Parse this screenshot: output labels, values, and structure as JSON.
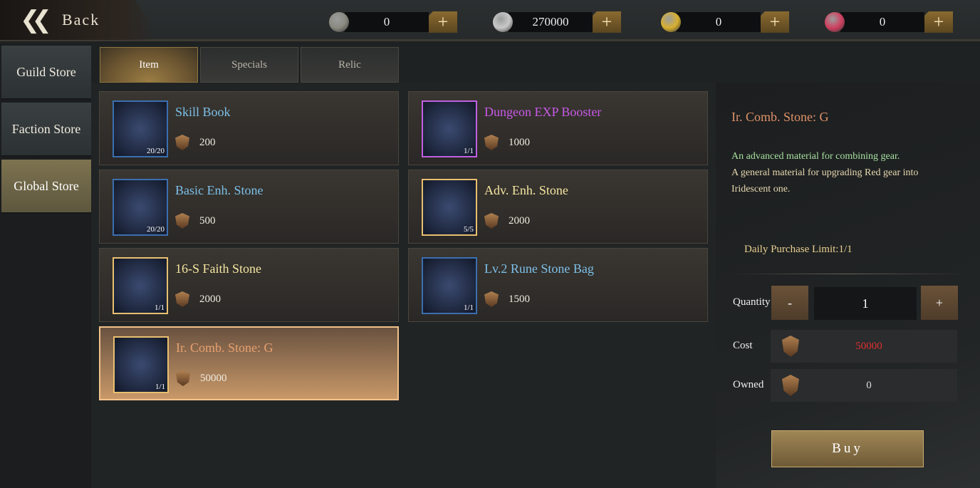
{
  "header": {
    "back_label": "Back",
    "currencies": [
      {
        "icon": "compass-coin-icon",
        "value": "0",
        "color": "#8a8a80"
      },
      {
        "icon": "silver-coin-icon",
        "value": "270000",
        "color": "#c8c8c8"
      },
      {
        "icon": "gold-coin-icon",
        "value": "0",
        "color": "#d8b030"
      },
      {
        "icon": "ruby-gem-icon",
        "value": "0",
        "color": "#d04060"
      }
    ]
  },
  "sidebar": {
    "items": [
      {
        "label": "Guild Store"
      },
      {
        "label": "Faction Store"
      },
      {
        "label": "Global Store",
        "active": true
      }
    ]
  },
  "tabs": [
    {
      "label": "Item",
      "active": true
    },
    {
      "label": "Specials"
    },
    {
      "label": "Relic"
    }
  ],
  "items": [
    {
      "name": "Skill Book",
      "price": "200",
      "count": "20/20",
      "color": "#7cc0e8"
    },
    {
      "name": "Dungeon EXP Booster",
      "price": "1000",
      "count": "1/1",
      "color": "#c85ae8"
    },
    {
      "name": "Basic Enh. Stone",
      "price": "500",
      "count": "20/20",
      "color": "#7cc0e8"
    },
    {
      "name": "Adv. Enh. Stone",
      "price": "2000",
      "count": "5/5",
      "color": "#f4e6a0"
    },
    {
      "name": "16-S Faith Stone",
      "price": "2000",
      "count": "1/1",
      "color": "#f4e6a0"
    },
    {
      "name": "Lv.2 Rune Stone Bag",
      "price": "1500",
      "count": "1/1",
      "color": "#7cc0e8"
    },
    {
      "name": "Ir. Comb. Stone: G",
      "price": "50000",
      "count": "1/1",
      "color": "#e8a070",
      "selected": true
    }
  ],
  "detail": {
    "title": "Ir. Comb. Stone: G",
    "desc1": "An advanced material for combining gear.",
    "desc2": "A general material for upgrading Red gear into Iridescent one.",
    "limit": "Daily Purchase Limit:1/1",
    "quantity_label": "Quantity",
    "minus": "-",
    "quantity": "1",
    "plus": "+",
    "cost_label": "Cost",
    "cost": "50000",
    "cost_color": "#e03030",
    "owned_label": "Owned",
    "owned": "0",
    "buy": "Buy"
  }
}
